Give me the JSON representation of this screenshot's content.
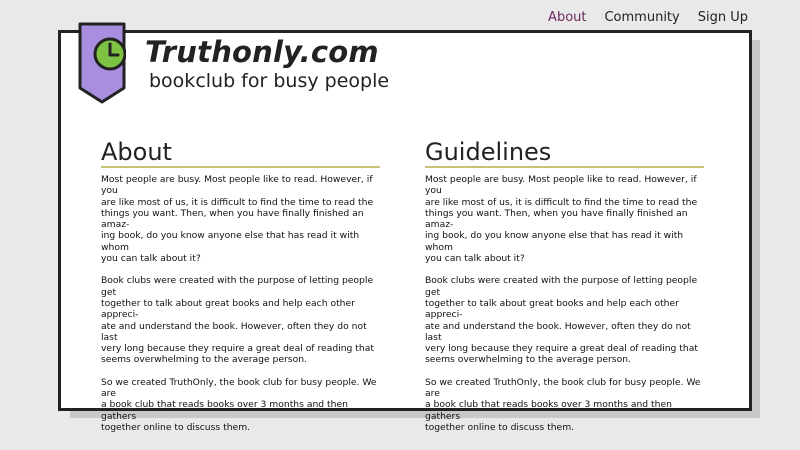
{
  "nav": {
    "items": [
      {
        "label": "About",
        "active": true
      },
      {
        "label": "Community",
        "active": false
      },
      {
        "label": "Sign Up",
        "active": false
      }
    ]
  },
  "brand": {
    "title": "Truthonly.com",
    "tagline": "bookclub for busy people",
    "logo_icon": "clock-bookmark-icon"
  },
  "colors": {
    "accent": "#6a2a5e",
    "bookmark": "#a98ee0",
    "clock": "#7dc242",
    "underline": "#c9c07a"
  },
  "sections": [
    {
      "title": "About",
      "paragraphs": [
        "Most people are busy. Most people like to read. However, if you\nare like most of us, it is difficult to find the time to read the\nthings you want. Then, when you have finally finished an amaz-\ning book, do you know anyone else that has read it with whom\nyou can talk about it?",
        "Book clubs were created with the purpose of letting people get\ntogether to talk about great books and help each other appreci-\nate and understand the book.  However, often they do not last\nvery long because they require a great deal of reading that\nseems overwhelming to the average person.",
        "So we created TruthOnly, the book club for busy people.  We are\na book club that reads books over 3 months and then gathers\ntogether online to discuss them."
      ]
    },
    {
      "title": "Guidelines",
      "paragraphs": [
        "Most people are busy. Most people like to read. However, if you\nare like most of us, it is difficult to find the time to read the\nthings you want. Then, when you have finally finished an amaz-\ning book, do you know anyone else that has read it with whom\nyou can talk about it?",
        "Book clubs were created with the purpose of letting people get\ntogether to talk about great books and help each other appreci-\nate and understand the book.  However, often they do not last\nvery long because they require a great deal of reading that\nseems overwhelming to the average person.",
        "So we created TruthOnly, the book club for busy people.  We are\na book club that reads books over 3 months and then gathers\ntogether online to discuss them."
      ]
    }
  ]
}
